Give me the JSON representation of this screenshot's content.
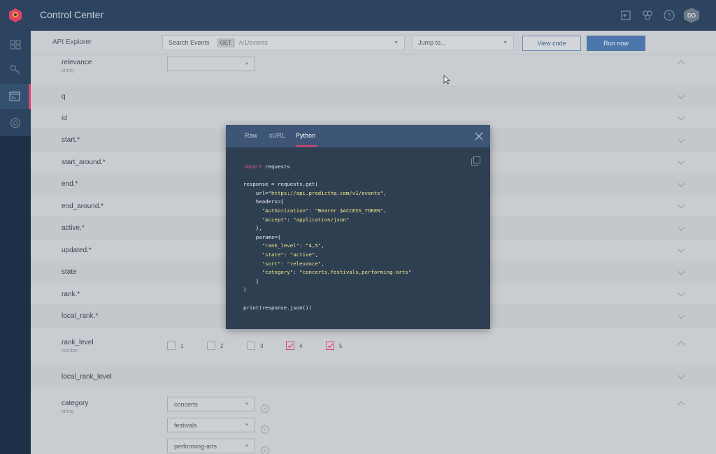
{
  "header": {
    "app_title": "Control Center",
    "avatar_initials": "DO"
  },
  "toolbar": {
    "section_label": "API Explorer",
    "endpoint_select": {
      "label": "Search Events",
      "method": "GET",
      "path": "/v1/events"
    },
    "jump_select": {
      "placeholder": "Jump to..."
    },
    "view_code_label": "View code",
    "run_now_label": "Run now"
  },
  "params": [
    {
      "name": "relevance",
      "type": "string"
    },
    {
      "name": "q"
    },
    {
      "name": "id"
    },
    {
      "name": "start.*"
    },
    {
      "name": "start_around.*"
    },
    {
      "name": "end.*"
    },
    {
      "name": "end_around.*"
    },
    {
      "name": "active.*"
    },
    {
      "name": "updated.*"
    },
    {
      "name": "state"
    },
    {
      "name": "rank.*"
    },
    {
      "name": "local_rank.*"
    },
    {
      "name": "rank_level",
      "type": "number"
    },
    {
      "name": "local_rank_level"
    },
    {
      "name": "category",
      "type": "string"
    }
  ],
  "rank_level_options": [
    {
      "label": "1",
      "checked": false
    },
    {
      "label": "2",
      "checked": false
    },
    {
      "label": "3",
      "checked": false
    },
    {
      "label": "4",
      "checked": true
    },
    {
      "label": "5",
      "checked": true
    }
  ],
  "category_values": [
    "concerts",
    "festivals",
    "performing-arts"
  ],
  "modal": {
    "tabs": [
      "Raw",
      "cURL",
      "Python"
    ],
    "active_tab": "Python",
    "code": {
      "l1_kw": "import",
      "l1_rest": " requests",
      "l3": "response = requests.get(",
      "l4_a": "    url=",
      "l4_str": "\"https://api.predicthq.com/v1/events\"",
      "l4_b": ",",
      "l5": "    headers={",
      "l6_k": "      \"Authorization\"",
      "l6_sep": ": ",
      "l6_v": "\"Bearer $ACCESS_TOKEN\"",
      "l6_end": ",",
      "l7_k": "      \"Accept\"",
      "l7_sep": ": ",
      "l7_v": "\"application/json\"",
      "l8": "    },",
      "l9": "    params={",
      "l10_k": "      \"rank_level\"",
      "l10_sep": ": ",
      "l10_v": "\"4,5\"",
      "l10_end": ",",
      "l11_k": "      \"state\"",
      "l11_sep": ": ",
      "l11_v": "\"active\"",
      "l11_end": ",",
      "l12_k": "      \"sort\"",
      "l12_sep": ": ",
      "l12_v": "\"relevance\"",
      "l12_end": ",",
      "l13_k": "      \"category\"",
      "l13_sep": ": ",
      "l13_v": "\"concerts,festivals,performing-arts\"",
      "l14": "    }",
      "l15": ")",
      "l17": "print(response.json())"
    }
  },
  "colors": {
    "nav_bg": "#2d4460",
    "accent": "#e0426c",
    "primary_button": "#4d77ab",
    "modal_bg": "#2f3f52"
  }
}
